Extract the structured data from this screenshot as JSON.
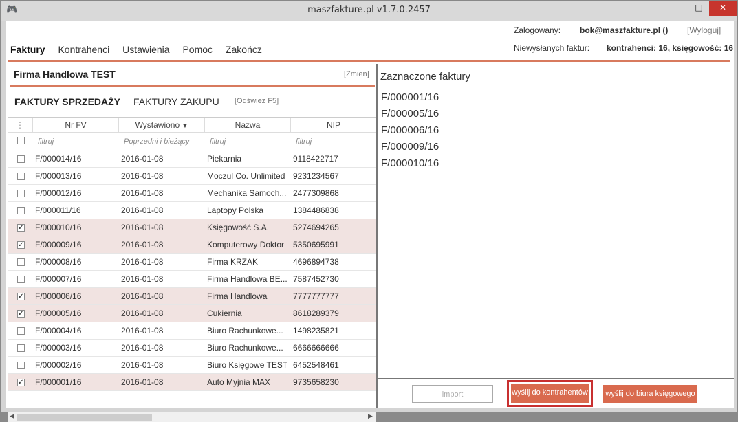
{
  "window": {
    "title": "maszfakture.pl  v1.7.0.2457"
  },
  "menu": {
    "items": [
      "Faktury",
      "Kontrahenci",
      "Ustawienia",
      "Pomoc",
      "Zakończ"
    ]
  },
  "login": {
    "label": "Zalogowany:",
    "user": "bok@maszfakture.pl ()",
    "logout": "[Wyloguj]",
    "unsent_label": "Niewysłanych faktur:",
    "unsent_value": "kontrahenci: 16, księgowość: 16"
  },
  "company": {
    "name": "Firma Handlowa TEST",
    "change": "[Zmień]"
  },
  "tabs": {
    "sales": "FAKTURY SPRZEDAŻY",
    "purchase": "FAKTURY ZAKUPU",
    "refresh": "[Odśwież F5]"
  },
  "grid": {
    "columns": [
      "Nr FV",
      "Wystawiono",
      "Nazwa",
      "NIP"
    ],
    "filters": [
      "filtruj",
      "Poprzedni i bieżący",
      "filtruj",
      "filtruj"
    ],
    "rows": [
      {
        "checked": false,
        "nr": "F/000014/16",
        "date": "2016-01-08",
        "name": "Piekarnia",
        "nip": "9118422717"
      },
      {
        "checked": false,
        "nr": "F/000013/16",
        "date": "2016-01-08",
        "name": "Moczul Co. Unlimited",
        "nip": "9231234567"
      },
      {
        "checked": false,
        "nr": "F/000012/16",
        "date": "2016-01-08",
        "name": "Mechanika Samoch...",
        "nip": "2477309868"
      },
      {
        "checked": false,
        "nr": "F/000011/16",
        "date": "2016-01-08",
        "name": "Laptopy Polska",
        "nip": "1384486838"
      },
      {
        "checked": true,
        "nr": "F/000010/16",
        "date": "2016-01-08",
        "name": "Księgowość S.A.",
        "nip": "5274694265"
      },
      {
        "checked": true,
        "nr": "F/000009/16",
        "date": "2016-01-08",
        "name": "Komputerowy Doktor",
        "nip": "5350695991"
      },
      {
        "checked": false,
        "nr": "F/000008/16",
        "date": "2016-01-08",
        "name": "Firma KRZAK",
        "nip": "4696894738"
      },
      {
        "checked": false,
        "nr": "F/000007/16",
        "date": "2016-01-08",
        "name": "Firma Handlowa BE...",
        "nip": "7587452730"
      },
      {
        "checked": true,
        "nr": "F/000006/16",
        "date": "2016-01-08",
        "name": "Firma Handlowa",
        "nip": "7777777777"
      },
      {
        "checked": true,
        "nr": "F/000005/16",
        "date": "2016-01-08",
        "name": "Cukiernia",
        "nip": "8618289379"
      },
      {
        "checked": false,
        "nr": "F/000004/16",
        "date": "2016-01-08",
        "name": "Biuro Rachunkowe...",
        "nip": "1498235821"
      },
      {
        "checked": false,
        "nr": "F/000003/16",
        "date": "2016-01-08",
        "name": "Biuro Rachunkowe...",
        "nip": "6666666666"
      },
      {
        "checked": false,
        "nr": "F/000002/16",
        "date": "2016-01-08",
        "name": "Biuro Księgowe TEST",
        "nip": "6452548461"
      },
      {
        "checked": true,
        "nr": "F/000001/16",
        "date": "2016-01-08",
        "name": "Auto Myjnia MAX",
        "nip": "9735658230"
      }
    ]
  },
  "selected": {
    "title": "Zaznaczone faktury",
    "items": [
      "F/000001/16",
      "F/000005/16",
      "F/000006/16",
      "F/000009/16",
      "F/000010/16"
    ]
  },
  "buttons": {
    "import": "import",
    "send_contractors": "wyślij do kontrahentów",
    "send_office": "wyślij do biura księgowego"
  },
  "colors": {
    "accent": "#d96a4e",
    "selected_row": "#f1e3e1",
    "highlight_border": "#c83030"
  }
}
